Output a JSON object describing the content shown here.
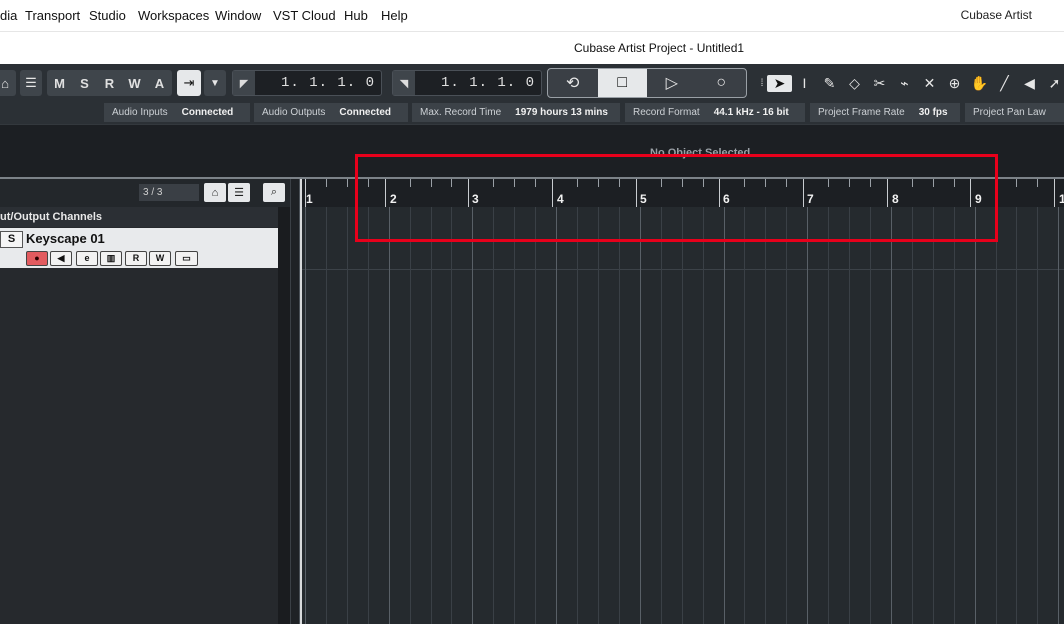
{
  "menubar": {
    "items": [
      "dia",
      "Transport",
      "Studio",
      "Workspaces",
      "Window",
      "VST Cloud",
      "Hub",
      "Help"
    ],
    "app_name": "Cubase Artist"
  },
  "window": {
    "title": "Cubase Artist Project - Untitled1"
  },
  "toolbar": {
    "msrwa": [
      "M",
      "S",
      "R",
      "W",
      "A"
    ],
    "left_locator": "1. 1. 1.   0",
    "right_locator": "1. 1. 1.   0",
    "transport": {
      "cycle_icon": "cycle-icon",
      "stop_icon": "stop-icon",
      "play_icon": "play-icon",
      "record_icon": "record-icon"
    },
    "tools": [
      "object-select-icon",
      "range-select-icon",
      "draw-icon",
      "erase-icon",
      "split-icon",
      "glue-icon",
      "mute-icon",
      "zoom-icon",
      "hand-icon",
      "line-icon",
      "speaker-icon",
      "more-icon"
    ]
  },
  "status": [
    {
      "key": "Audio Inputs",
      "value": "Connected"
    },
    {
      "key": "Audio Outputs",
      "value": "Connected"
    },
    {
      "key": "Max. Record Time",
      "value": "1979 hours 13 mins"
    },
    {
      "key": "Record Format",
      "value": "44.1 kHz - 16 bit"
    },
    {
      "key": "Project Frame Rate",
      "value": "30 fps"
    },
    {
      "key": "Project Pan Law",
      "value": ""
    }
  ],
  "infoline": {
    "text": "No Object Selected"
  },
  "tracklist": {
    "counter": "3 / 3",
    "folder_label": "ut/Output Channels",
    "track": {
      "solo": "S",
      "name": "Keyscape 01",
      "read": "R",
      "write": "W"
    }
  },
  "ruler": {
    "bars": [
      "1",
      "2",
      "3",
      "4",
      "5",
      "6",
      "7",
      "8",
      "9",
      "1"
    ]
  },
  "colors": {
    "highlight": "#e8001b",
    "background": "#22262a",
    "record": "#e25b5f"
  }
}
